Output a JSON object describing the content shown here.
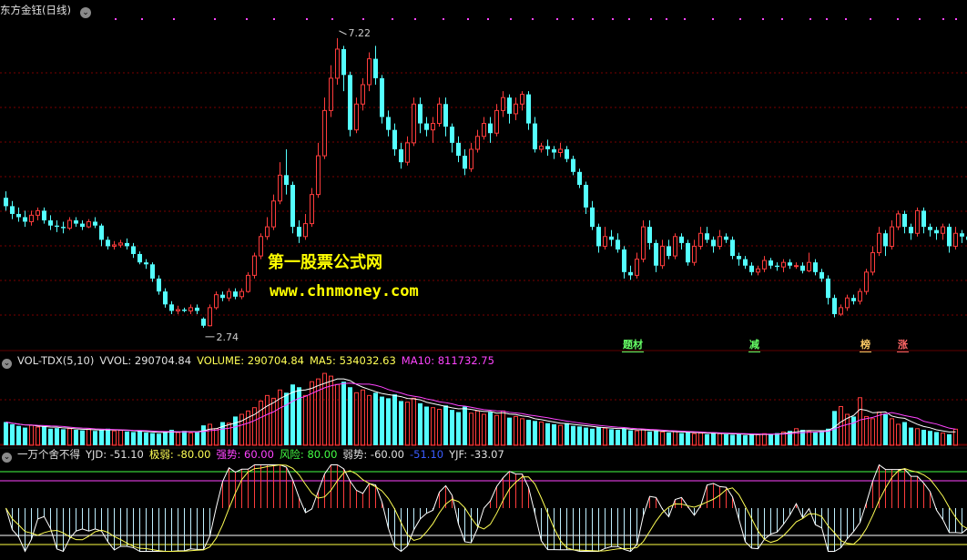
{
  "price_panel": {
    "title": "东方金钰(日线)",
    "high_label": "7.22",
    "low_label": "2.74",
    "tags": [
      {
        "text": "题材",
        "color": "#66ff66"
      },
      {
        "text": "减",
        "color": "#66ff66"
      },
      {
        "text": "榜",
        "color": "#ffcc66"
      },
      {
        "text": "涨",
        "color": "#ff6666"
      }
    ]
  },
  "volume_panel": {
    "indicator": "VOL-TDX(5,10)",
    "vvol": "VVOL: 290704.84",
    "volume": "VOLUME: 290704.84",
    "ma5": "MA5: 534032.63",
    "ma10": "MA10: 811732.75"
  },
  "indicator_panel": {
    "name": "一万个舍不得",
    "yjd": "YJD: -51.10",
    "jiruo": "极弱: -80.00",
    "qiangshi": "强势: 60.00",
    "fengxian": "风险: 80.00",
    "ruoshi": "弱势: -60.00",
    "blue_val": "-51.10",
    "yjf": "YJF: -33.07"
  },
  "watermark": {
    "line1": "第一股票公式网",
    "line2": "www.chnmoney.com"
  },
  "colors": {
    "up": "#ff3c3c",
    "down": "#54ffff",
    "grid": "#7a0000",
    "ma5": "#ffffff",
    "ma10": "#ff44ff",
    "yjd": "#ffffff",
    "yjf": "#ffff55",
    "qiangshi": "#ff44ff",
    "fengxian": "#44ff44",
    "jiruo": "#ffff44",
    "accent": "#ffff00"
  },
  "chart_data": {
    "type": "candlestick",
    "price_ylim": [
      2.4,
      7.5
    ],
    "price_max": 7.22,
    "price_min": 2.74,
    "candles": [
      [
        4.75,
        4.62,
        4.85,
        4.55
      ],
      [
        4.62,
        4.5,
        4.7,
        4.42
      ],
      [
        4.5,
        4.45,
        4.6,
        4.38
      ],
      [
        4.45,
        4.38,
        4.55,
        4.3
      ],
      [
        4.38,
        4.48,
        4.55,
        4.32
      ],
      [
        4.48,
        4.55,
        4.6,
        4.4
      ],
      [
        4.55,
        4.4,
        4.6,
        4.35
      ],
      [
        4.4,
        4.32,
        4.48,
        4.25
      ],
      [
        4.32,
        4.3,
        4.4,
        4.22
      ],
      [
        4.3,
        4.28,
        4.38,
        4.2
      ],
      [
        4.28,
        4.4,
        4.45,
        4.25
      ],
      [
        4.4,
        4.35,
        4.45,
        4.3
      ],
      [
        4.35,
        4.3,
        4.4,
        4.25
      ],
      [
        4.3,
        4.38,
        4.42,
        4.28
      ],
      [
        4.38,
        4.32,
        4.45,
        4.28
      ],
      [
        4.32,
        4.1,
        4.35,
        4.0
      ],
      [
        4.1,
        4.0,
        4.15,
        3.95
      ],
      [
        4.0,
        4.02,
        4.08,
        3.95
      ],
      [
        4.02,
        4.05,
        4.1,
        3.98
      ],
      [
        4.05,
        4.0,
        4.12,
        3.95
      ],
      [
        4.0,
        3.88,
        4.05,
        3.82
      ],
      [
        3.88,
        3.75,
        3.92,
        3.72
      ],
      [
        3.75,
        3.72,
        3.8,
        3.65
      ],
      [
        3.72,
        3.5,
        3.75,
        3.45
      ],
      [
        3.5,
        3.3,
        3.55,
        3.25
      ],
      [
        3.3,
        3.1,
        3.35,
        3.05
      ],
      [
        3.1,
        3.0,
        3.15,
        2.95
      ],
      [
        3.0,
        3.02,
        3.08,
        2.95
      ],
      [
        3.02,
        3.0,
        3.05,
        2.98
      ],
      [
        3.0,
        3.05,
        3.1,
        2.95
      ],
      [
        3.05,
        3.0,
        3.1,
        2.95
      ],
      [
        2.88,
        2.77,
        2.9,
        2.74
      ],
      [
        2.77,
        3.05,
        3.1,
        2.76
      ],
      [
        3.05,
        3.25,
        3.3,
        3.02
      ],
      [
        3.25,
        3.2,
        3.3,
        3.15
      ],
      [
        3.2,
        3.3,
        3.35,
        3.15
      ],
      [
        3.3,
        3.22,
        3.35,
        3.18
      ],
      [
        3.22,
        3.3,
        3.35,
        3.18
      ],
      [
        3.3,
        3.55,
        3.6,
        3.28
      ],
      [
        3.55,
        3.85,
        3.9,
        3.5
      ],
      [
        3.85,
        4.15,
        4.2,
        3.8
      ],
      [
        4.15,
        4.3,
        4.45,
        4.1
      ],
      [
        4.3,
        4.7,
        4.8,
        4.25
      ],
      [
        4.7,
        5.1,
        5.3,
        4.65
      ],
      [
        5.1,
        4.95,
        5.5,
        4.8
      ],
      [
        4.95,
        4.3,
        5.0,
        4.2
      ],
      [
        4.3,
        4.15,
        4.4,
        4.05
      ],
      [
        4.15,
        4.35,
        4.5,
        4.1
      ],
      [
        4.35,
        4.8,
        4.9,
        4.3
      ],
      [
        4.8,
        5.4,
        5.6,
        4.75
      ],
      [
        5.4,
        6.1,
        6.3,
        5.35
      ],
      [
        6.1,
        6.6,
        6.8,
        6.0
      ],
      [
        6.6,
        7.05,
        7.22,
        6.5
      ],
      [
        7.05,
        6.65,
        7.1,
        6.4
      ],
      [
        6.65,
        5.8,
        6.7,
        5.7
      ],
      [
        5.8,
        6.2,
        6.3,
        5.75
      ],
      [
        6.2,
        6.5,
        6.6,
        6.1
      ],
      [
        6.5,
        6.9,
        7.0,
        6.4
      ],
      [
        6.9,
        6.6,
        7.1,
        6.5
      ],
      [
        6.6,
        6.0,
        6.65,
        5.9
      ],
      [
        6.0,
        5.8,
        6.1,
        5.7
      ],
      [
        5.8,
        5.5,
        5.9,
        5.4
      ],
      [
        5.5,
        5.3,
        5.6,
        5.2
      ],
      [
        5.3,
        5.6,
        5.7,
        5.25
      ],
      [
        5.6,
        6.2,
        6.3,
        5.55
      ],
      [
        6.2,
        5.9,
        6.3,
        5.75
      ],
      [
        5.9,
        5.8,
        6.0,
        5.7
      ],
      [
        5.8,
        5.9,
        6.0,
        5.6
      ],
      [
        5.9,
        6.2,
        6.3,
        5.85
      ],
      [
        6.2,
        5.85,
        6.3,
        5.7
      ],
      [
        5.85,
        5.6,
        5.9,
        5.45
      ],
      [
        5.6,
        5.4,
        5.7,
        5.3
      ],
      [
        5.4,
        5.2,
        5.5,
        5.1
      ],
      [
        5.2,
        5.5,
        5.6,
        5.15
      ],
      [
        5.5,
        5.7,
        5.8,
        5.45
      ],
      [
        5.7,
        5.9,
        6.0,
        5.65
      ],
      [
        5.9,
        5.75,
        6.0,
        5.6
      ],
      [
        5.75,
        6.1,
        6.2,
        5.7
      ],
      [
        6.1,
        6.3,
        6.4,
        6.0
      ],
      [
        6.3,
        6.05,
        6.35,
        5.9
      ],
      [
        6.05,
        6.2,
        6.3,
        5.95
      ],
      [
        6.2,
        6.35,
        6.4,
        6.1
      ],
      [
        6.35,
        5.9,
        6.4,
        5.8
      ],
      [
        5.9,
        5.5,
        6.0,
        5.45
      ],
      [
        5.5,
        5.55,
        5.6,
        5.45
      ],
      [
        5.55,
        5.5,
        5.65,
        5.4
      ],
      [
        5.5,
        5.45,
        5.55,
        5.35
      ],
      [
        5.45,
        5.5,
        5.6,
        5.38
      ],
      [
        5.5,
        5.35,
        5.55,
        5.3
      ],
      [
        5.35,
        5.15,
        5.4,
        5.1
      ],
      [
        5.15,
        4.95,
        5.2,
        4.9
      ],
      [
        4.95,
        4.6,
        5.0,
        4.5
      ],
      [
        4.6,
        4.3,
        4.7,
        4.25
      ],
      [
        4.3,
        4.0,
        4.35,
        3.9
      ],
      [
        4.0,
        4.15,
        4.3,
        3.95
      ],
      [
        4.15,
        4.1,
        4.25,
        4.0
      ],
      [
        4.1,
        3.95,
        4.2,
        3.9
      ],
      [
        3.95,
        3.6,
        4.0,
        3.5
      ],
      [
        3.6,
        3.55,
        3.7,
        3.48
      ],
      [
        3.55,
        3.8,
        3.9,
        3.5
      ],
      [
        3.8,
        4.3,
        4.4,
        3.75
      ],
      [
        4.3,
        4.05,
        4.4,
        3.95
      ],
      [
        4.05,
        3.7,
        4.1,
        3.6
      ],
      [
        3.7,
        4.0,
        4.1,
        3.65
      ],
      [
        4.0,
        3.85,
        4.1,
        3.8
      ],
      [
        3.85,
        4.15,
        4.2,
        3.8
      ],
      [
        4.15,
        4.05,
        4.2,
        3.95
      ],
      [
        4.05,
        3.75,
        4.1,
        3.7
      ],
      [
        3.75,
        4.0,
        4.1,
        3.7
      ],
      [
        4.0,
        4.2,
        4.3,
        3.95
      ],
      [
        4.2,
        4.1,
        4.3,
        4.05
      ],
      [
        4.1,
        4.0,
        4.15,
        3.9
      ],
      [
        4.0,
        4.15,
        4.25,
        3.95
      ],
      [
        4.15,
        4.1,
        4.2,
        4.05
      ],
      [
        4.1,
        3.85,
        4.15,
        3.8
      ],
      [
        3.85,
        3.8,
        3.9,
        3.7
      ],
      [
        3.8,
        3.7,
        3.85,
        3.65
      ],
      [
        3.7,
        3.6,
        3.75,
        3.55
      ],
      [
        3.6,
        3.65,
        3.7,
        3.55
      ],
      [
        3.65,
        3.78,
        3.85,
        3.6
      ],
      [
        3.78,
        3.7,
        3.82,
        3.65
      ],
      [
        3.7,
        3.68,
        3.75,
        3.62
      ],
      [
        3.68,
        3.75,
        3.8,
        3.6
      ],
      [
        3.75,
        3.7,
        3.8,
        3.65
      ],
      [
        3.7,
        3.7,
        3.75,
        3.65
      ],
      [
        3.7,
        3.62,
        3.75,
        3.58
      ],
      [
        3.62,
        3.75,
        3.9,
        3.6
      ],
      [
        3.75,
        3.6,
        3.8,
        3.55
      ],
      [
        3.6,
        3.5,
        3.65,
        3.45
      ],
      [
        3.5,
        3.2,
        3.55,
        3.1
      ],
      [
        3.2,
        2.95,
        3.25,
        2.9
      ],
      [
        2.95,
        3.05,
        3.1,
        2.92
      ],
      [
        3.05,
        3.2,
        3.25,
        3.0
      ],
      [
        3.2,
        3.15,
        3.25,
        3.1
      ],
      [
        3.15,
        3.3,
        3.35,
        3.1
      ],
      [
        3.3,
        3.6,
        3.65,
        3.25
      ],
      [
        3.6,
        3.9,
        4.0,
        3.55
      ],
      [
        3.9,
        4.2,
        4.3,
        3.85
      ],
      [
        4.2,
        4.0,
        4.25,
        3.85
      ],
      [
        4.0,
        4.3,
        4.4,
        3.95
      ],
      [
        4.3,
        4.5,
        4.55,
        4.25
      ],
      [
        4.5,
        4.3,
        4.55,
        4.2
      ],
      [
        4.3,
        4.2,
        4.35,
        4.1
      ],
      [
        4.2,
        4.55,
        4.6,
        4.15
      ],
      [
        4.55,
        4.3,
        4.6,
        4.2
      ],
      [
        4.3,
        4.25,
        4.35,
        4.15
      ],
      [
        4.25,
        4.2,
        4.3,
        4.1
      ],
      [
        4.2,
        4.3,
        4.35,
        4.1
      ],
      [
        4.3,
        4.0,
        4.35,
        3.9
      ],
      [
        4.0,
        4.2,
        4.3,
        3.95
      ],
      [
        4.2,
        4.15,
        4.25,
        4.05
      ],
      [
        4.15,
        4.1,
        4.2,
        4.0
      ]
    ],
    "volume_ylim": [
      0,
      1400000
    ],
    "volumes": [
      420000,
      380000,
      350000,
      320000,
      360000,
      330000,
      340000,
      300000,
      310000,
      290000,
      300000,
      280000,
      270000,
      290000,
      260000,
      280000,
      300000,
      260000,
      270000,
      250000,
      240000,
      260000,
      230000,
      220000,
      210000,
      250000,
      280000,
      230000,
      260000,
      220000,
      240000,
      360000,
      380000,
      300000,
      420000,
      400000,
      520000,
      560000,
      620000,
      680000,
      800000,
      900000,
      850000,
      1000000,
      950000,
      1100000,
      1050000,
      900000,
      1150000,
      1200000,
      1300000,
      1250000,
      1100000,
      1150000,
      1050000,
      950000,
      1000000,
      900000,
      950000,
      880000,
      850000,
      920000,
      800000,
      780000,
      850000,
      760000,
      700000,
      680000,
      650000,
      720000,
      640000,
      600000,
      700000,
      580000,
      620000,
      560000,
      600000,
      540000,
      620000,
      500000,
      520000,
      480000,
      460000,
      440000,
      420000,
      400000,
      380000,
      360000,
      400000,
      350000,
      340000,
      320000,
      300000,
      330000,
      310000,
      290000,
      280000,
      300000,
      270000,
      260000,
      280000,
      250000,
      260000,
      240000,
      230000,
      250000,
      220000,
      240000,
      210000,
      220000,
      200000,
      230000,
      210000,
      200000,
      190000,
      210000,
      180000,
      200000,
      190000,
      210000,
      200000,
      220000,
      240000,
      260000,
      300000,
      280000,
      250000,
      230000,
      260000,
      300000,
      620000,
      700000,
      560000,
      520000,
      860000,
      520000,
      480000,
      600000,
      560000,
      480000,
      380000,
      420000,
      320000,
      300000,
      280000,
      260000,
      240000,
      220000,
      200000,
      290704.84
    ],
    "ind_ylim": [
      -100,
      100
    ],
    "levels": {
      "fengxian": 80,
      "qiangshi": 60,
      "ruoshi": -60,
      "jiruo": -80
    }
  }
}
